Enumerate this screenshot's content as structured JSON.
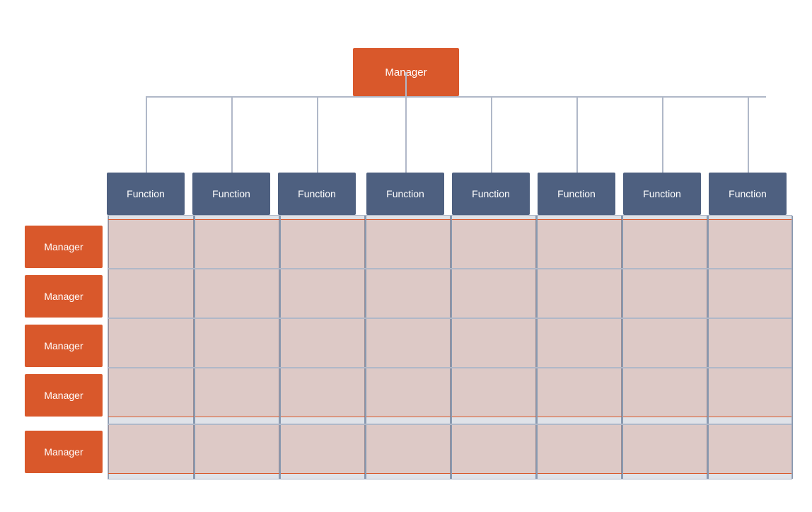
{
  "colors": {
    "manager_orange": "#d9582b",
    "function_blue": "#4e6080",
    "line_color": "#b0b8c8",
    "row_band": "rgba(217,88,43,0.18)",
    "col_band": "rgba(78,96,128,0.18)"
  },
  "top_manager": {
    "label": "Manager"
  },
  "functions": [
    {
      "label": "Function",
      "col": 0
    },
    {
      "label": "Function",
      "col": 1
    },
    {
      "label": "Function",
      "col": 2
    },
    {
      "label": "Function",
      "col": 3
    },
    {
      "label": "Function",
      "col": 4
    },
    {
      "label": "Function",
      "col": 5
    },
    {
      "label": "Function",
      "col": 6
    },
    {
      "label": "Function",
      "col": 7
    }
  ],
  "managers_left": [
    {
      "label": "Manager"
    },
    {
      "label": "Manager"
    },
    {
      "label": "Manager"
    },
    {
      "label": "Manager"
    },
    {
      "label": "Manager"
    }
  ]
}
